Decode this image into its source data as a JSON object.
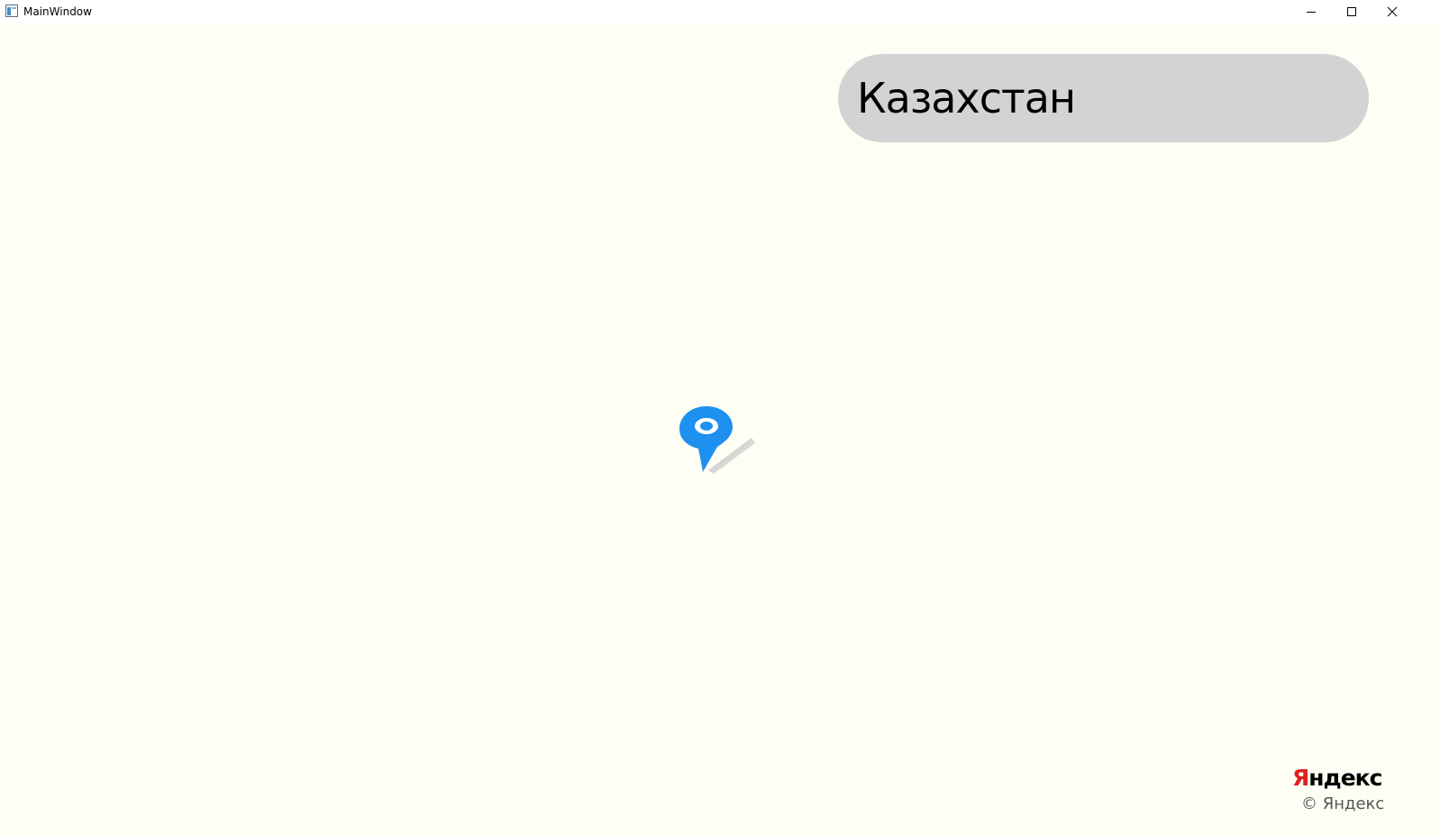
{
  "window": {
    "title": "MainWindow"
  },
  "search": {
    "value": "Казахстан"
  },
  "map": {
    "marker_icon": "map-pin-icon",
    "marker_color": "#1e90f0"
  },
  "attribution": {
    "logo_first_letter": "Я",
    "logo_rest": "ндекс",
    "copyright": "© Яндекс"
  },
  "colors": {
    "map_background": "#fffef5",
    "search_background": "#d3d3d3",
    "logo_red": "#e01f1f"
  }
}
